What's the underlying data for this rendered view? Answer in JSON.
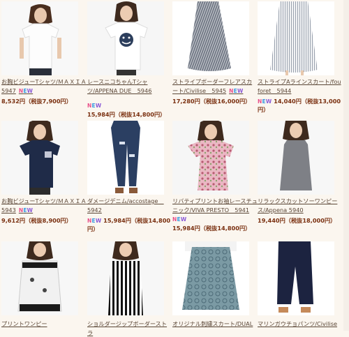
{
  "new_badge": [
    "N",
    "E",
    "W"
  ],
  "products": [
    {
      "title": "お胸ビジューTシャツ/ＭＡＸＩＡ　5947",
      "price": "8,532円（税抜7,900円）",
      "new": true,
      "image": "tshirt-white-model"
    },
    {
      "title": "レースニコちゃんTシャツ/APPENA DUE　5946",
      "price": "15,984円（税抜14,800円）",
      "new": true,
      "image": "tshirt-smiley-model"
    },
    {
      "title": "ストライプボーダーフレアスカート/Civilise　5945",
      "price": "17,280円（税抜16,000円）",
      "new": true,
      "image": "flare-skirt-grey-stripe"
    },
    {
      "title": "ストライプAラインスカート/fou foret　5944",
      "price": "14,040円（税抜13,000円）",
      "new": true,
      "image": "a-line-skirt-white-stripe"
    },
    {
      "title": "お胸ビジューTシャツ/ＭＡＸＩＡ　5943",
      "price": "9,612円（税抜8,900円）",
      "new": true,
      "image": "tshirt-navy-model"
    },
    {
      "title": "ダメージデニム/accostage　5942",
      "price": "15,984円（税抜14,800円）",
      "new": true,
      "image": "damaged-denim"
    },
    {
      "title": "リバティプリントお袖レースチュニック/VIVA PRESTO　5941",
      "price": "15,984円（税抜14,800円）",
      "new": true,
      "image": "liberty-tunic-model"
    },
    {
      "title": "リラックスカットソーワンピース/Appena 5940",
      "price": "19,440円（税抜18,000円）",
      "new": true,
      "image": "grey-dress-model"
    },
    {
      "title": "プリントワンピー",
      "price": "",
      "new": false,
      "image": "print-dress-model"
    },
    {
      "title": "ショルダージップボーダーストラ",
      "price": "",
      "new": false,
      "image": "stripe-dress-model"
    },
    {
      "title": "オリジナル刺繍スカート/DUAL",
      "price": "",
      "new": false,
      "image": "embroidered-skirt"
    },
    {
      "title": "マリンガウチョパンツ/Civilise",
      "price": "",
      "new": false,
      "image": "navy-gaucho-pants"
    }
  ]
}
